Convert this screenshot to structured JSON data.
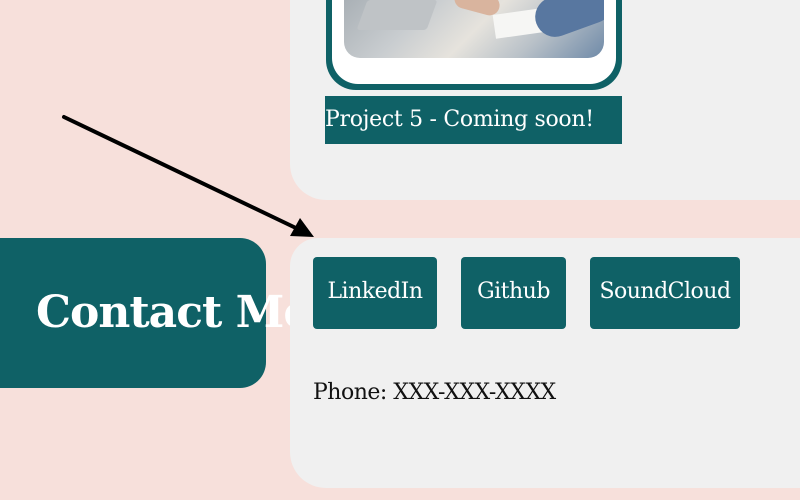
{
  "projects": {
    "photo_icon": "project-photo",
    "caption": "Project 5 - Coming soon!"
  },
  "contact": {
    "title": "Contact Me",
    "links": {
      "linkedin": "LinkedIn",
      "github": "Github",
      "soundcloud": "SoundCloud"
    },
    "phone": "Phone: XXX-XXX-XXXX"
  },
  "colors": {
    "background": "#f7e0db",
    "panel": "#f0f0f0",
    "accent": "#0f6166",
    "text_on_accent": "#ffffff",
    "text": "#111111"
  }
}
